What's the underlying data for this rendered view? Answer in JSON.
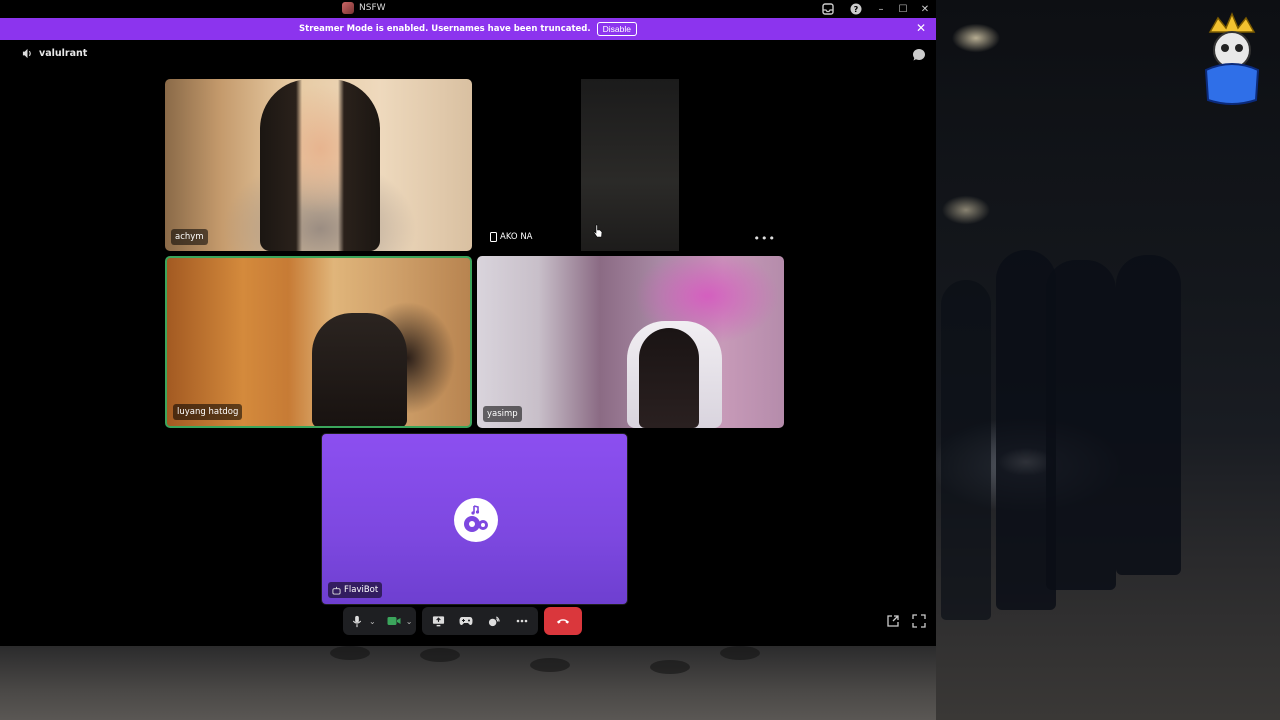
{
  "window": {
    "title": "NSFW",
    "controls": [
      "inbox-icon",
      "help-icon",
      "minimize-icon",
      "maximize-icon",
      "close-icon"
    ]
  },
  "banner": {
    "message": "Streamer Mode is enabled. Usernames have been truncated.",
    "disable_label": "Disable",
    "color": "#8c34ee"
  },
  "channel": {
    "name": "valulrant",
    "icon": "speaker-icon"
  },
  "participants": [
    {
      "name": "achym",
      "speaking": false
    },
    {
      "name": "AKO NA",
      "device": "mobile-icon",
      "speaking": false
    },
    {
      "name": "luyang hatdog",
      "speaking": true
    },
    {
      "name": "yasimp",
      "speaking": false
    },
    {
      "name": "FlaviBot",
      "icon": "bot-icon",
      "speaking": false
    }
  ],
  "more_label": "•••",
  "controls": {
    "mic": "microphone-icon",
    "camera": "camera-icon",
    "screenshare": "screen-share-icon",
    "activity": "gamepad-icon",
    "soundboard": "soundboard-icon",
    "more": "more-icon",
    "hangup": "hangup-icon"
  },
  "colors": {
    "speaking_ring": "#3ba55c",
    "hangup": "#da373c",
    "bot_tile": "#8c4ff0"
  }
}
